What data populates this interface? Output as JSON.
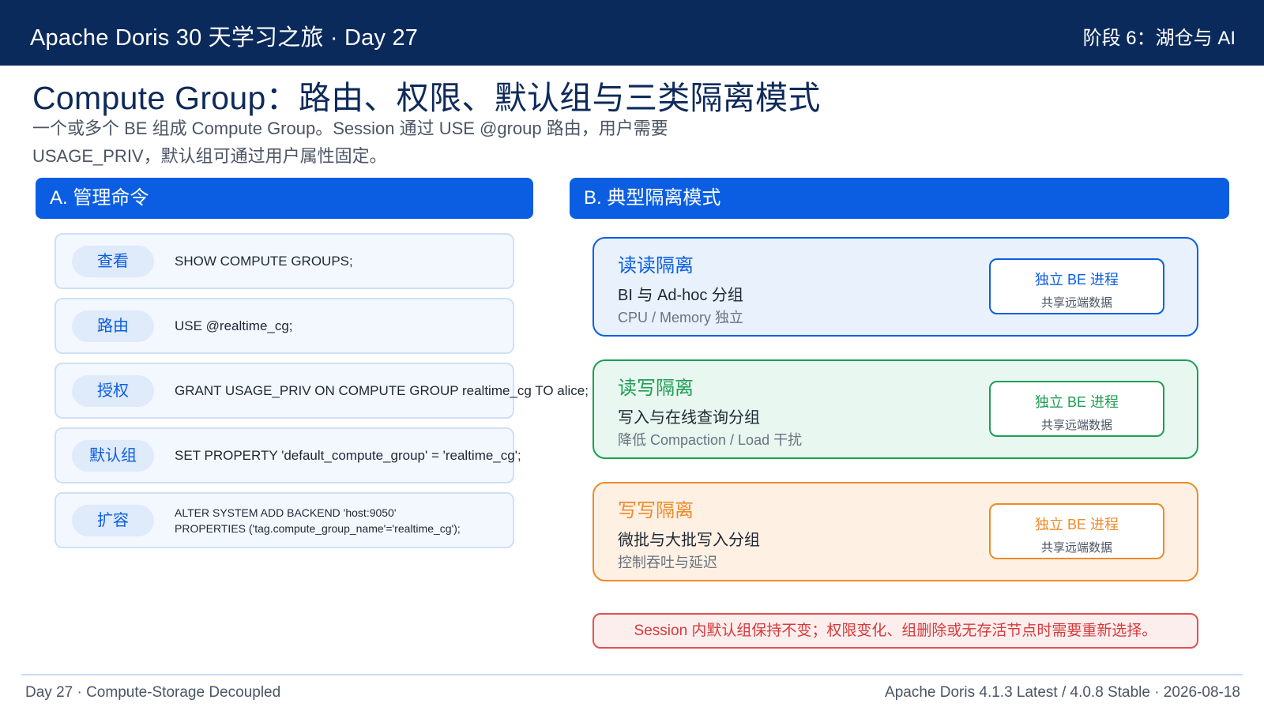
{
  "header": {
    "left_title": "Apache Doris 30 天学习之旅 · Day 27",
    "right_stage": "阶段 6：湖仓与 AI"
  },
  "title": "Compute Group：路由、权限、默认组与三类隔离模式",
  "subtitle_lines": [
    "一个或多个 BE 组成 Compute Group。Session 通过 USE @group 路由，用户需要",
    "USAGE_PRIV，默认组可通过用户属性固定。"
  ],
  "section_a": {
    "heading": "A. 管理命令",
    "commands": [
      {
        "label": "查看",
        "lines": [
          "SHOW COMPUTE GROUPS;"
        ]
      },
      {
        "label": "路由",
        "lines": [
          "USE @realtime_cg;"
        ]
      },
      {
        "label": "授权",
        "lines": [
          "GRANT USAGE_PRIV ON COMPUTE GROUP realtime_cg TO alice;"
        ]
      },
      {
        "label": "默认组",
        "lines": [
          "SET PROPERTY 'default_compute_group' = 'realtime_cg';"
        ]
      },
      {
        "label": "扩容",
        "lines": [
          "ALTER SYSTEM ADD BACKEND 'host:9050'",
          "PROPERTIES ('tag.compute_group_name'='realtime_cg');"
        ]
      }
    ]
  },
  "section_b": {
    "heading": "B. 典型隔离模式",
    "modes": [
      {
        "title": "读读隔离",
        "line1": "BI 与 Ad-hoc 分组",
        "line2": "CPU / Memory 独立",
        "box_title": "独立 BE 进程",
        "box_sub": "共享远端数据",
        "color": "#0b5ee2"
      },
      {
        "title": "读写隔离",
        "line1": "写入与在线查询分组",
        "line2": "降低 Compaction / Load 干扰",
        "box_title": "独立 BE 进程",
        "box_sub": "共享远端数据",
        "color": "#1f9d55"
      },
      {
        "title": "写写隔离",
        "line1": "微批与大批写入分组",
        "line2": "控制吞吐与延迟",
        "box_title": "独立 BE 进程",
        "box_sub": "共享远端数据",
        "color": "#ee8a2a"
      }
    ],
    "warning": "Session 内默认组保持不变；权限变化、组删除或无存活节点时需要重新选择。"
  },
  "footer": {
    "left": "Day 27 · Compute-Storage Decoupled",
    "right": "Apache Doris 4.1.3 Latest / 4.0.8 Stable · 2026-08-18"
  }
}
